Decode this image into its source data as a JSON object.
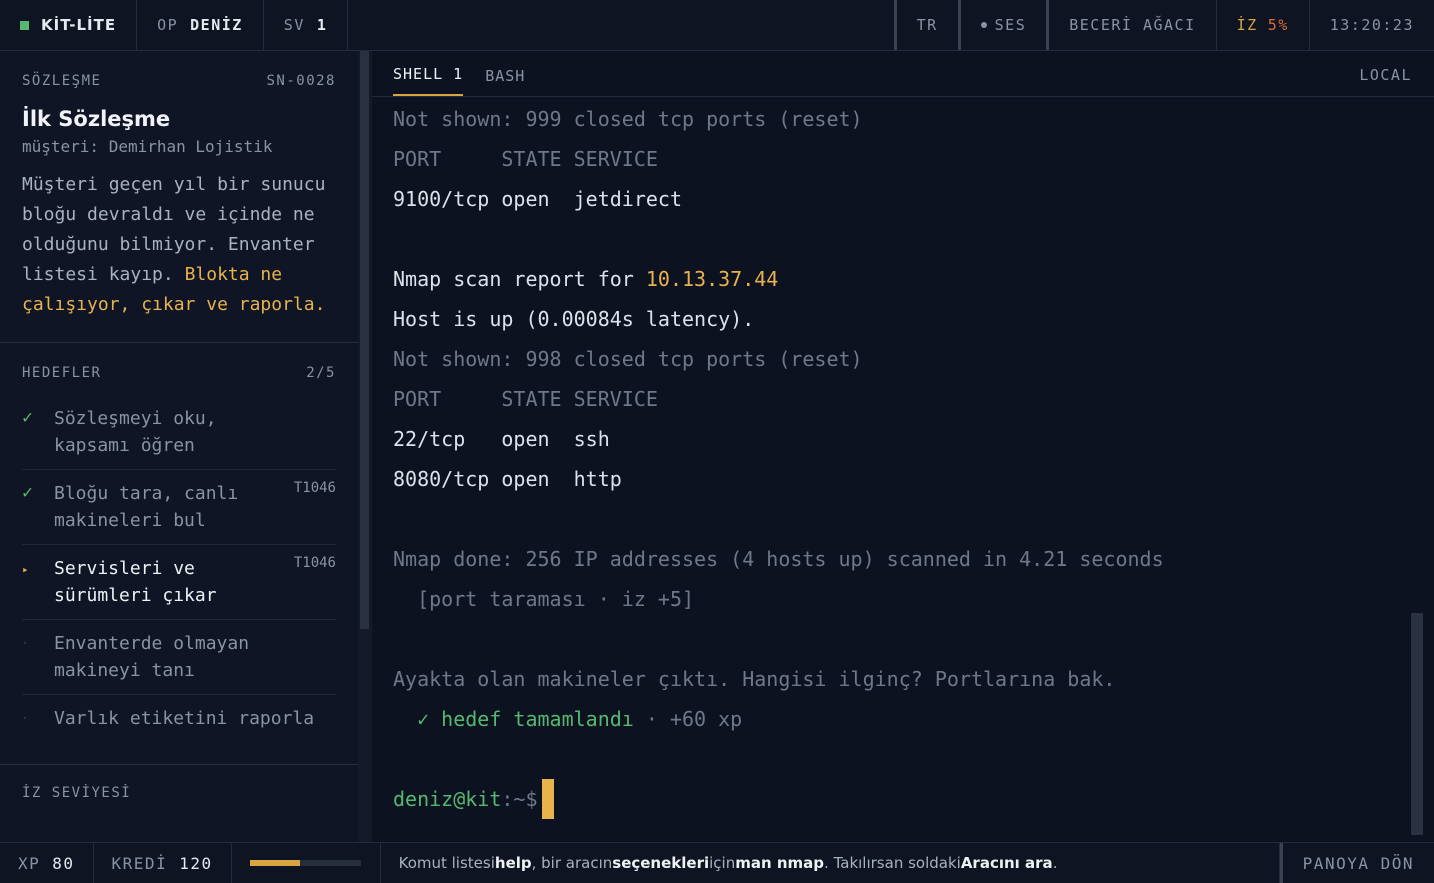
{
  "topbar": {
    "brand": "KİT-LİTE",
    "op_label": "OP",
    "op_value": "DENİZ",
    "sv_label": "SV",
    "sv_value": "1",
    "lang": "TR",
    "sound": "SES",
    "skill_tree": "BECERİ AĞACI",
    "trace_label": "İZ",
    "trace_value": "5%",
    "clock": "13:20:23"
  },
  "contract": {
    "section_label": "SÖZLEŞME",
    "id": "SN-0028",
    "title": "İlk Sözleşme",
    "client": "müşteri: Demirhan Lojistik",
    "desc_plain": "Müşteri geçen yıl bir sunucu bloğu devraldı ve içinde ne olduğunu bilmiyor. Envanter listesi kayıp. ",
    "desc_highlight": "Blokta ne çalışıyor, çıkar ve raporla."
  },
  "goals": {
    "label": "HEDEFLER",
    "count": "2/5",
    "items": [
      {
        "mark": "✓",
        "text": "Sözleşmeyi oku, kapsamı öğren",
        "tag": ""
      },
      {
        "mark": "✓",
        "text": "Bloğu tara, canlı makineleri bul",
        "tag": "T1046"
      },
      {
        "mark": "▸",
        "text": "Servisleri ve sürümleri çıkar",
        "tag": "T1046"
      },
      {
        "mark": "·",
        "text": "Envanterde olmayan makineyi tanı",
        "tag": ""
      },
      {
        "mark": "·",
        "text": "Varlık etiketini raporla",
        "tag": ""
      }
    ]
  },
  "trace_section": {
    "label": "İZ SEVİYESİ"
  },
  "tabs": {
    "shell1": "SHELL 1",
    "bash": "BASH",
    "local": "LOCAL"
  },
  "terminal": {
    "l1": "Not shown: 999 closed tcp ports (reset)",
    "l2": "PORT     STATE SERVICE",
    "l3": "9100/tcp open  jetdirect",
    "l4_pre": "Nmap scan report for ",
    "l4_ip": "10.13.37.44",
    "l5": "Host is up (0.00084s latency).",
    "l6": "Not shown: 998 closed tcp ports (reset)",
    "l7": "PORT     STATE SERVICE",
    "l8": "22/tcp   open  ssh",
    "l9": "8080/tcp open  http",
    "l10": "Nmap done: 256 IP addresses (4 hosts up) scanned in 4.21 seconds",
    "l11": "  [port taraması · iz +5]",
    "l12": "Ayakta olan makineler çıktı. Hangisi ilginç? Portlarına bak.",
    "l13_check": "  ✓ hedef tamamlandı",
    "l13_xp": " · +60 xp",
    "prompt": "deniz@kit",
    "prompt_tail": ":~$"
  },
  "bottom": {
    "xp_label": "XP",
    "xp_value": "80",
    "credit_label": "KREDİ",
    "credit_value": "120",
    "progress_fraction": 0.45,
    "hint_1": "Komut listesi ",
    "hint_2": "help",
    "hint_3": ", bir aracın ",
    "hint_4": "seçenekleri",
    "hint_5": " için ",
    "hint_6": "man nmap",
    "hint_7": ". Takılırsan soldaki ",
    "hint_8": "Aracını ara",
    "hint_9": ".",
    "back": "PANOYA DÖN"
  }
}
